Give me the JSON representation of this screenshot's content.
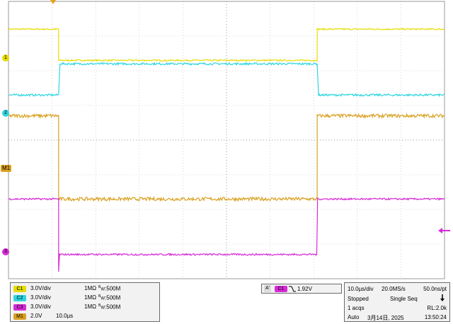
{
  "colors": {
    "ch1": "#e6dc00",
    "ch2": "#2ed5e0",
    "ch3": "#d62ad6",
    "math": "#d9a020",
    "grid": "#b7b7b7",
    "panel_bg": "#f2f2f2"
  },
  "markers": {
    "ch1": "1",
    "ch2": "2",
    "ch3": "3",
    "math": "M1"
  },
  "channels": [
    {
      "chip": "C1",
      "scale": "3.0V/div",
      "impedance": "1MΩ",
      "bw_prefix": "B",
      "bw_sub": "W",
      "bw_value": ":500M"
    },
    {
      "chip": "C2",
      "scale": "3.0V/div",
      "impedance": "1MΩ",
      "bw_prefix": "B",
      "bw_sub": "W",
      "bw_value": ":500M"
    },
    {
      "chip": "C3",
      "scale": "3.0V/div",
      "impedance": "1MΩ",
      "bw_prefix": "B",
      "bw_sub": "W",
      "bw_value": ":500M"
    }
  ],
  "math": {
    "chip": "M1",
    "scale": "2.0V",
    "time": "10.0µs"
  },
  "trigger": {
    "label": "A'",
    "source": "C1",
    "slope_icon": "falling-edge-icon",
    "level": "1.92V"
  },
  "acquisition": {
    "timebase": "10.0µs/div",
    "sample_rate": "20.0MS/s",
    "resolution": "50.0ns/pt",
    "state": "Stopped",
    "mode": "Single Seq",
    "acqs": "1 acqs",
    "record_length": "RL:2.0k",
    "trigger_mode": "Auto",
    "date": "3月14日, 2025",
    "time": "13:50:24"
  },
  "chart_data": {
    "type": "line",
    "xlabel": "",
    "ylabel": "",
    "xlim": [
      0,
      10
    ],
    "ylim": [
      0,
      8
    ],
    "grid": true,
    "series": [
      {
        "channel": "ch1",
        "x": [
          0,
          1.15,
          1.15,
          7.08,
          7.08,
          10
        ],
        "y": [
          7.2,
          7.2,
          6.3,
          6.3,
          7.2,
          7.2
        ],
        "noise": 0.02
      },
      {
        "channel": "ch2",
        "x": [
          0,
          1.15,
          1.18,
          7.08,
          7.11,
          10
        ],
        "y": [
          5.3,
          5.3,
          6.2,
          6.2,
          5.3,
          5.3
        ],
        "noise": 0.03
      },
      {
        "channel": "math",
        "x": [
          0,
          1.15,
          1.15,
          7.08,
          7.08,
          10
        ],
        "y": [
          4.7,
          4.7,
          2.3,
          2.3,
          4.7,
          4.7
        ],
        "noise": 0.05
      },
      {
        "channel": "ch3",
        "x": [
          0,
          1.15,
          1.15,
          1.17,
          7.05,
          7.07,
          7.09,
          10
        ],
        "y": [
          2.3,
          2.3,
          0.2,
          0.7,
          0.7,
          0.7,
          2.3,
          2.3
        ],
        "noise": 0.025
      }
    ]
  }
}
